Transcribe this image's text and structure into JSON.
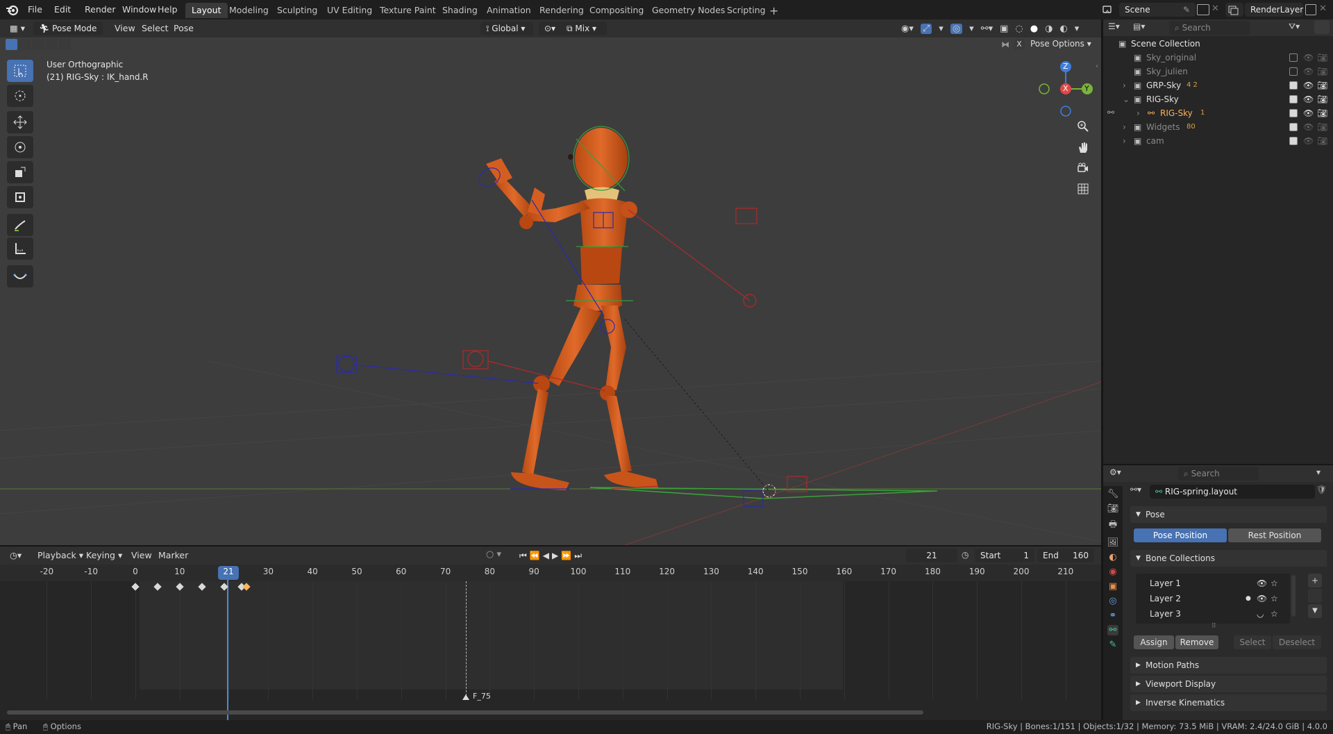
{
  "menus": [
    "File",
    "Edit",
    "Render",
    "Window",
    "Help"
  ],
  "workspaces": [
    "Layout",
    "Modeling",
    "Sculpting",
    "UV Editing",
    "Texture Paint",
    "Shading",
    "Animation",
    "Rendering",
    "Compositing",
    "Geometry Nodes",
    "Scripting"
  ],
  "scene": {
    "name": "Scene",
    "view_layer": "RenderLayer"
  },
  "viewport": {
    "mode": "Pose Mode",
    "menus": [
      "View",
      "Select",
      "Pose"
    ],
    "orientation": "Global",
    "pivot_mix": "Mix",
    "overlay_title": "User Orthographic",
    "overlay_subtitle": "(21) RIG-Sky : IK_hand.R",
    "pose_options": "Pose Options",
    "x_toggle": "X",
    "gizmo": {
      "x": "X",
      "y": "Y",
      "z": "Z"
    }
  },
  "timeline": {
    "menus": [
      "Playback",
      "Keying",
      "View",
      "Marker"
    ],
    "current_frame": "21",
    "start_label": "Start",
    "start": "1",
    "end_label": "End",
    "end": "160",
    "ticks": [
      "-20",
      "-10",
      "0",
      "10",
      "21",
      "30",
      "40",
      "50",
      "60",
      "70",
      "80",
      "90",
      "100",
      "110",
      "120",
      "130",
      "140",
      "150",
      "160",
      "170",
      "180",
      "190",
      "200",
      "210"
    ],
    "marker": "F_75",
    "keyframes": [
      0,
      5,
      10,
      15,
      20,
      24,
      25
    ]
  },
  "outliner": {
    "search_placeholder": "Search",
    "root": "Scene Collection",
    "items": [
      {
        "label": "Sky_original",
        "dim": true
      },
      {
        "label": "Sky_julien",
        "dim": true
      },
      {
        "label": "GRP-Sky",
        "extra": "4  2"
      },
      {
        "label": "RIG-Sky"
      },
      {
        "label": "RIG-Sky",
        "extra": "1",
        "selected": true
      },
      {
        "label": "Widgets",
        "extra": "80",
        "dim": true
      },
      {
        "label": "cam",
        "dim": true
      }
    ]
  },
  "properties": {
    "search_placeholder": "Search",
    "datablock": "RIG-spring.layout",
    "pose_panel": "Pose",
    "pose_position": "Pose Position",
    "rest_position": "Rest Position",
    "bone_collections": "Bone Collections",
    "layers": [
      "Layer 1",
      "Layer 2",
      "Layer 3"
    ],
    "assign": "Assign",
    "remove": "Remove",
    "select": "Select",
    "deselect": "Deselect",
    "panels": [
      "Motion Paths",
      "Viewport Display",
      "Inverse Kinematics"
    ]
  },
  "status": {
    "left_pan": "Pan",
    "left_options": "Options",
    "right": "RIG-Sky | Bones:1/151 | Objects:1/32 | Memory: 73.5 MiB | VRAM: 2.4/24.0 GiB | 4.0.0"
  },
  "colors": {
    "accent": "#4772b3",
    "character": "#d2561a",
    "selected_bone": "#ffb35a",
    "axis_x": "#e04848",
    "axis_y": "#7ab33a",
    "axis_z": "#3f7ed8"
  }
}
